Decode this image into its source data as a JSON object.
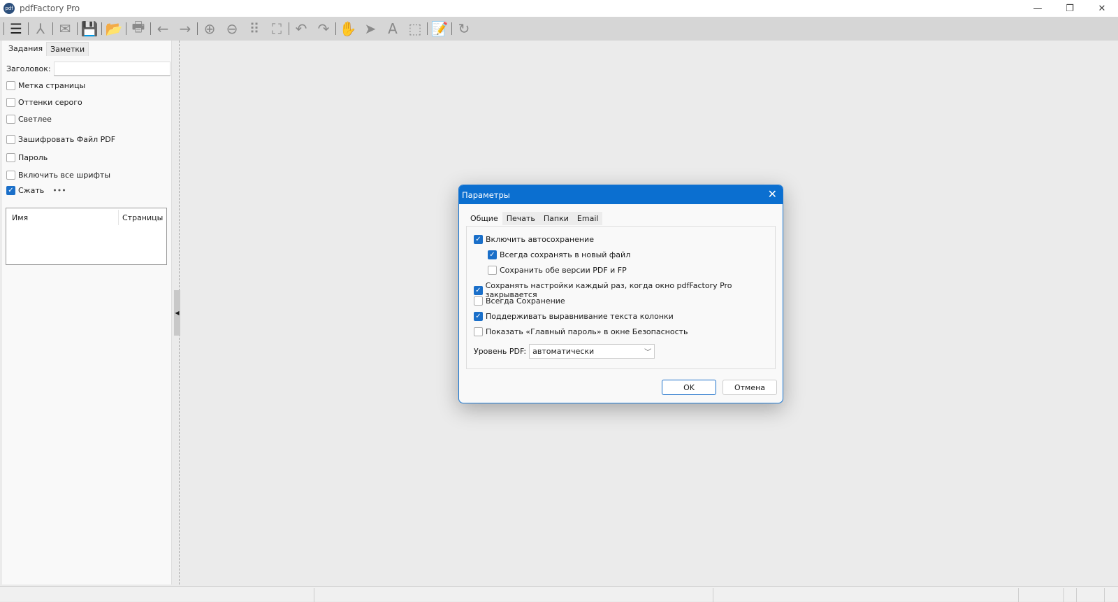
{
  "app": {
    "title": "pdfFactory Pro",
    "logo": "pdf"
  },
  "toolbar": {
    "icons": [
      "menu-icon",
      "acrobat-icon",
      "mail-icon",
      "save-icon",
      "open-folder-icon",
      "print-icon",
      "back-arrow-icon",
      "forward-arrow-icon",
      "zoom-in-icon",
      "zoom-out-icon",
      "grid-icon",
      "fit-page-icon",
      "undo-icon",
      "redo-icon",
      "hand-icon",
      "pointer-icon",
      "text-icon",
      "select-rect-icon",
      "notes-icon",
      "refresh-icon"
    ],
    "accent": "#e37a16"
  },
  "left": {
    "tabs": [
      "Задания",
      "Заметки"
    ],
    "title_label": "Заголовок:",
    "title_value": "",
    "options": [
      {
        "label": "Метка страницы",
        "checked": false
      },
      {
        "label": "Оттенки серого",
        "checked": false
      },
      {
        "label": "Светлее",
        "checked": false
      },
      {
        "label": "Зашифровать Файл PDF",
        "checked": false
      },
      {
        "label": "Пароль",
        "checked": false
      },
      {
        "label": "Включить все шрифты",
        "checked": false
      },
      {
        "label": "Сжать",
        "checked": true
      }
    ],
    "more": "•••",
    "columns": [
      "Имя",
      "Страницы"
    ]
  },
  "dialog": {
    "title": "Параметры",
    "tabs": [
      "Общие",
      "Печать",
      "Папки",
      "Email"
    ],
    "options": [
      {
        "label": "Включить автосохранение",
        "checked": true
      },
      {
        "label": "Всегда сохранять в новый файл",
        "checked": true
      },
      {
        "label": "Сохранить обе версии PDF и FP",
        "checked": false
      },
      {
        "label": "Сохранять настройки каждый раз, когда окно pdfFactory Pro закрывается",
        "checked": true
      },
      {
        "label": "Всегда Сохранение",
        "checked": false
      },
      {
        "label": "Поддерживать выравнивание текста колонки",
        "checked": true
      },
      {
        "label": "Показать «Главный пароль» в окне Безопасность",
        "checked": false
      }
    ],
    "pdf_level_label": "Уровень PDF:",
    "pdf_level_value": "автоматически",
    "ok": "OK",
    "cancel": "Отмена",
    "accent": "#0b6fd0"
  }
}
